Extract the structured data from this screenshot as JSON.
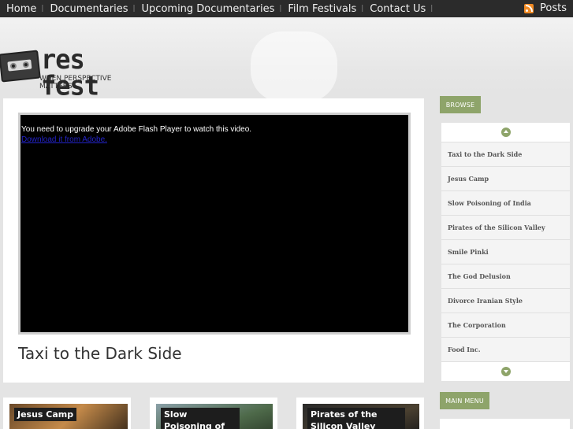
{
  "nav": {
    "items": [
      "Home",
      "Documentaries",
      "Upcoming Documentaries",
      "Film Festivals",
      "Contact Us"
    ],
    "separator": "|",
    "rss_icon": "rss-feed-icon",
    "rss_label": "Posts"
  },
  "logo": {
    "text": "res fest",
    "tagline": "WHEN PERSPECTIVE MATTERS"
  },
  "video": {
    "flash_message": "You need to upgrade your Adobe Flash Player to watch this video.",
    "flash_link": "Download it from Adobe.",
    "title": "Taxi to the Dark Side"
  },
  "thumbnails": [
    {
      "caption": "Jesus Camp"
    },
    {
      "caption": "Slow Poisoning of India"
    },
    {
      "caption": "Pirates of the Silicon Valley"
    }
  ],
  "sidebar": {
    "browse_label": "BROWSE",
    "main_menu_label": "MAIN MENU",
    "items": [
      "Taxi to the Dark Side",
      "Jesus Camp",
      "Slow Poisoning of India",
      "Pirates of the Silicon Valley",
      "Smile Pinki",
      "The God Delusion",
      "Divorce Iranian Style",
      "The Corporation",
      "Food Inc."
    ]
  },
  "colors": {
    "accent": "#8ea46a",
    "nav_bg": "#2b2b2b",
    "page_bg": "#e4e4e4"
  }
}
